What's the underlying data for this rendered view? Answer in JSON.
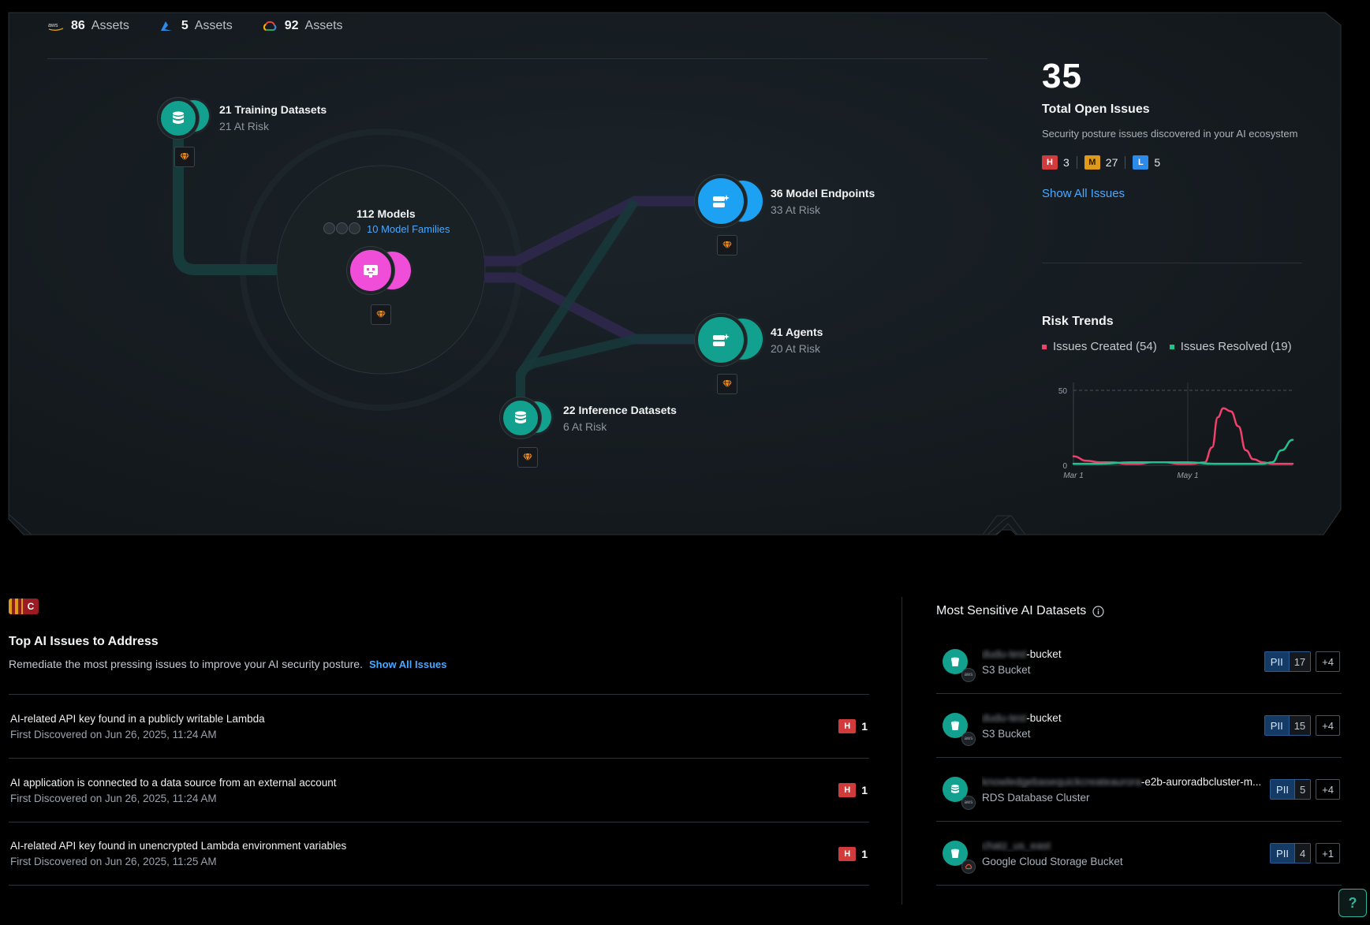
{
  "cloud_assets": [
    {
      "provider_icon": "aws-icon",
      "count": "86",
      "label": "Assets"
    },
    {
      "provider_icon": "azure-icon",
      "count": "5",
      "label": "Assets"
    },
    {
      "provider_icon": "gcp-icon",
      "count": "92",
      "label": "Assets"
    }
  ],
  "graph": {
    "training": {
      "title": "21 Training Datasets",
      "sub": "21 At Risk",
      "icon": "database-icon",
      "color": "#12a08f"
    },
    "models": {
      "title": "112 Models",
      "families": "10 Model Families",
      "icon": "model-icon",
      "color": "#f04ed8"
    },
    "endpoints": {
      "title": "36 Model Endpoints",
      "sub": "33 At Risk",
      "icon": "endpoint-icon",
      "color": "#1da1f2"
    },
    "agents": {
      "title": "41 Agents",
      "sub": "20 At Risk",
      "icon": "agent-icon",
      "color": "#12a08f"
    },
    "inference": {
      "title": "22 Inference Datasets",
      "sub": "6 At Risk",
      "icon": "database-icon",
      "color": "#12a08f"
    },
    "risk_chip_icon": "risk-gem-icon"
  },
  "summary": {
    "total": "35",
    "title": "Total Open Issues",
    "desc": "Security posture issues discovered in your AI ecosystem",
    "high": {
      "letter": "H",
      "count": "3"
    },
    "medium": {
      "letter": "M",
      "count": "27"
    },
    "low": {
      "letter": "L",
      "count": "5"
    },
    "show_all": "Show All Issues"
  },
  "risk_trends": {
    "title": "Risk Trends",
    "created_label": "Issues Created (54)",
    "resolved_label": "Issues Resolved (19)",
    "created_color": "#f0416b",
    "resolved_color": "#1fc28d"
  },
  "chart_data": {
    "type": "line",
    "title": "Risk Trends",
    "x_ticks": [
      "Mar 1",
      "May 1"
    ],
    "y_ticks": [
      0,
      50
    ],
    "ylim": [
      0,
      50
    ],
    "grid": "dashed line at 50, vertical line at May 1",
    "series": [
      {
        "name": "Issues Created (54)",
        "color": "#f0416b",
        "x": [
          "Mar 1",
          "Mar 8",
          "Mar 15",
          "Mar 22",
          "Mar 29",
          "Apr 5",
          "Apr 12",
          "Apr 19",
          "Apr 26",
          "May 3",
          "May 10",
          "May 14",
          "May 17",
          "May 20",
          "May 24",
          "May 28",
          "Jun 1",
          "Jun 5",
          "Jun 10",
          "Jun 15",
          "Jun 20",
          "Jun 26"
        ],
        "values": [
          6,
          3,
          2,
          2,
          1,
          1,
          2,
          2,
          1,
          1,
          2,
          12,
          32,
          38,
          36,
          26,
          10,
          4,
          2,
          1,
          1,
          1
        ]
      },
      {
        "name": "Issues Resolved (19)",
        "color": "#1fc28d",
        "x": [
          "Mar 1",
          "Mar 15",
          "Apr 1",
          "Apr 15",
          "May 1",
          "May 15",
          "Jun 1",
          "Jun 10",
          "Jun 15",
          "Jun 20",
          "Jun 26"
        ],
        "values": [
          1,
          1,
          2,
          2,
          2,
          1,
          1,
          1,
          2,
          10,
          17
        ]
      }
    ]
  },
  "top_issues": {
    "badge": "C",
    "title": "Top AI Issues to Address",
    "desc": "Remediate the most pressing issues to improve your AI security posture.",
    "show_all": "Show All Issues",
    "rows": [
      {
        "title": "AI-related API key found in a publicly writable Lambda",
        "sub": "First Discovered on Jun 26, 2025, 11:24 AM",
        "sev": "H",
        "count": "1"
      },
      {
        "title": "AI application is connected to a data source from an external account",
        "sub": "First Discovered on Jun 26, 2025, 11:24 AM",
        "sev": "H",
        "count": "1"
      },
      {
        "title": "AI-related API key found in unencrypted Lambda environment variables",
        "sub": "First Discovered on Jun 26, 2025, 11:25 AM",
        "sev": "H",
        "count": "1"
      }
    ]
  },
  "datasets": {
    "title": "Most Sensitive AI Datasets",
    "info_icon": "info-icon",
    "rows": [
      {
        "hidden": "dudu-test",
        "name": "-bucket",
        "type": "S3 Bucket",
        "icon": "bucket-icon",
        "provider": "aws",
        "pii": "PII",
        "pii_count": "17",
        "more": "+4"
      },
      {
        "hidden": "dudu-test",
        "name": "-bucket",
        "type": "S3 Bucket",
        "icon": "bucket-icon",
        "provider": "aws",
        "pii": "PII",
        "pii_count": "15",
        "more": "+4"
      },
      {
        "hidden": "knowledgebasequickcreateaurora",
        "name": "-e2b-auroradbcluster-m...",
        "type": "RDS Database Cluster",
        "icon": "database-icon",
        "provider": "aws",
        "pii": "PII",
        "pii_count": "5",
        "more": "+4"
      },
      {
        "hidden": "chatz_us_east",
        "name": "",
        "type": "Google Cloud Storage Bucket",
        "icon": "bucket-icon",
        "provider": "gcp",
        "pii": "PII",
        "pii_count": "4",
        "more": "+1"
      }
    ]
  },
  "help": {
    "label": "?"
  }
}
